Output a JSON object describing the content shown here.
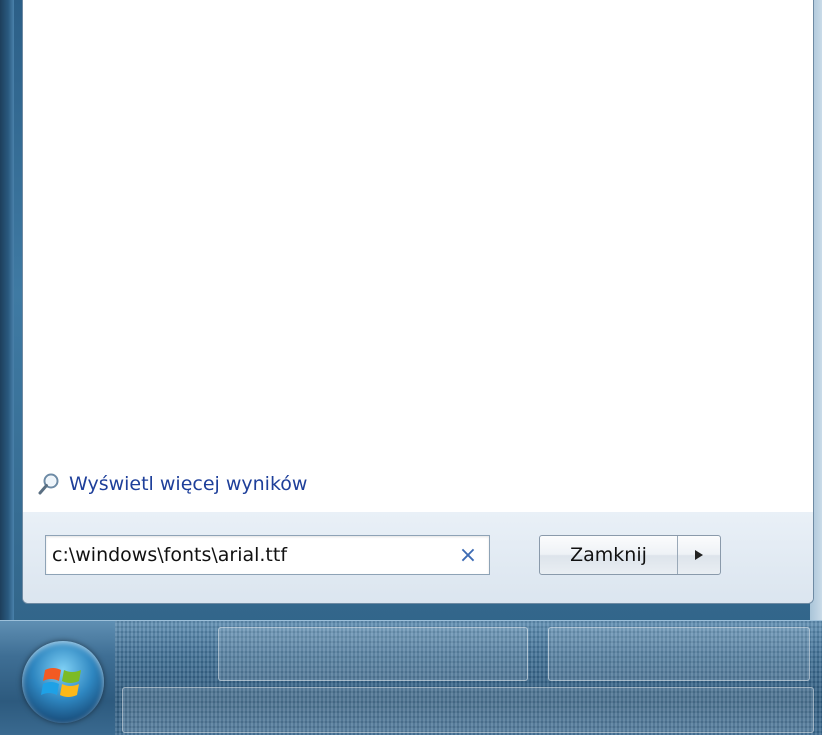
{
  "start_menu": {
    "more_results_label": "Wyświetl więcej wyników",
    "search": {
      "value": "c:\\windows\\fonts\\arial.ttf",
      "clear_glyph": "×"
    },
    "shutdown": {
      "label": "Zamknij",
      "arrow_icon": "triangle-right-icon"
    }
  },
  "icons": {
    "more_results": "search-magnifier-icon",
    "start": "windows-logo-icon"
  },
  "colors": {
    "link": "#1e3f9a",
    "clear": "#3d6bb3",
    "panel_bg": "#dfe8f1",
    "results_bg": "#ffffff"
  }
}
